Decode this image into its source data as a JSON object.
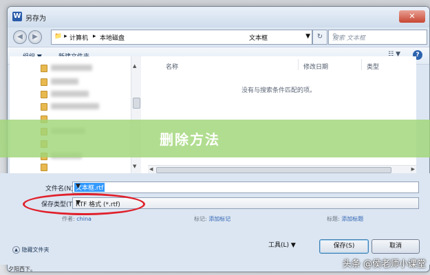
{
  "window": {
    "title": "另存为",
    "app_icon_letter": "W",
    "close_label": "✕"
  },
  "address_bar": {
    "back": "◀",
    "forward": "▶",
    "breadcrumb": [
      "计算机",
      "本地磁盘",
      "文本框"
    ],
    "search_placeholder": "搜索 文本框"
  },
  "toolbar": {
    "organize": "组织 ▼",
    "new_folder": "新建文件夹",
    "view": "☷ ▼",
    "help": "?"
  },
  "file_list": {
    "columns": [
      "名称",
      "修改日期",
      "类型"
    ],
    "empty_message": "没有与搜索条件匹配的项。"
  },
  "form": {
    "filename_label": "文件名(N):",
    "filename_value": "文本框.rtf",
    "filetype_label": "保存类型(T):",
    "filetype_value": "RTF 格式 (*.rtf)",
    "author_label": "作者:",
    "author_value": "china",
    "tags_label": "标记:",
    "tags_value": "添加标记",
    "title_label": "标题:",
    "title_value": "添加标题",
    "hide_folders": "隐藏文件夹",
    "tools_label": "工具(L)",
    "save_label": "保存(S)",
    "cancel_label": "取消"
  },
  "bottom_text": "夕阳西下。",
  "overlay": {
    "banner_title": "删除方法",
    "watermark": "头条 @侯老师小课堂"
  },
  "colors": {
    "banner": "#a0d678",
    "highlight": "#e0202b"
  }
}
